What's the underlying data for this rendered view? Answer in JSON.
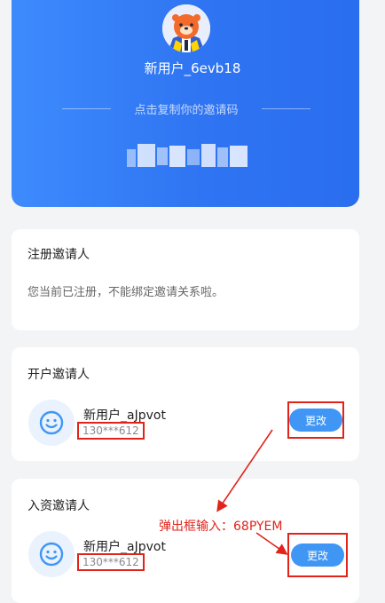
{
  "profile": {
    "username": "新用户_6evb18",
    "copy_hint": "点击复制你的邀请码"
  },
  "register_inviter": {
    "title": "注册邀请人",
    "message": "您当前已注册，不能绑定邀请关系啦。"
  },
  "account_inviter": {
    "title": "开户邀请人",
    "name": "新用户_aJpvot",
    "phone": "130***612",
    "change_label": "更改"
  },
  "fund_inviter": {
    "title": "入资邀请人",
    "name": "新用户_aJpvot",
    "phone": "130***612",
    "change_label": "更改"
  },
  "annotation": {
    "text": "弹出框输入：68PYEM"
  },
  "colors": {
    "primary_blue": "#2f74f2",
    "button_blue": "#3f96f5",
    "annotation_red": "#e2231a",
    "background": "#f3f4f6"
  },
  "icons": [
    "mascot-avatar-icon",
    "smiley-avatar-icon",
    "annotation-arrow"
  ]
}
